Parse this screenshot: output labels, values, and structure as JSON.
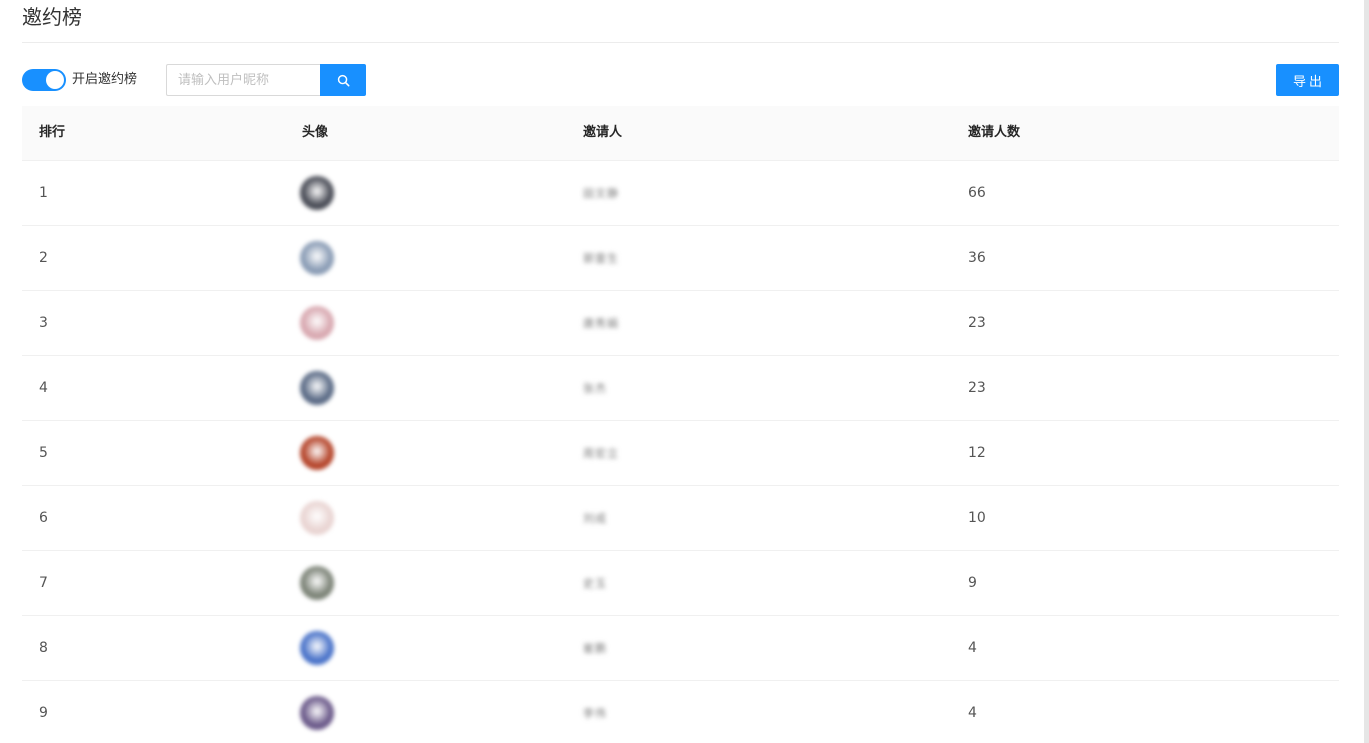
{
  "page": {
    "title": "邀约榜"
  },
  "toolbar": {
    "switch_on": true,
    "switch_label": "开启邀约榜",
    "search_placeholder": "请输入用户昵称",
    "search_icon": "search-icon",
    "export_label": "导出"
  },
  "colors": {
    "primary": "#1890ff"
  },
  "table": {
    "headers": {
      "rank": "排行",
      "avatar": "头像",
      "inviter": "邀请人",
      "count": "邀请人数"
    },
    "rows": [
      {
        "rank": "1",
        "name": "田文静",
        "count": "66",
        "avatar_color": "#4a4d57"
      },
      {
        "rank": "2",
        "name": "郭雷生",
        "count": "36",
        "avatar_color": "#8a9cb5"
      },
      {
        "rank": "3",
        "name": "唐秀娟",
        "count": "23",
        "avatar_color": "#d8a8b0"
      },
      {
        "rank": "4",
        "name": "张杰",
        "count": "23",
        "avatar_color": "#5b6b86"
      },
      {
        "rank": "5",
        "name": "周宏立",
        "count": "12",
        "avatar_color": "#b5452b"
      },
      {
        "rank": "6",
        "name": "刘成",
        "count": "10",
        "avatar_color": "#e9d4d2"
      },
      {
        "rank": "7",
        "name": "史玉",
        "count": "9",
        "avatar_color": "#7d8478"
      },
      {
        "rank": "8",
        "name": "崔鹏",
        "count": "4",
        "avatar_color": "#4a73c9"
      },
      {
        "rank": "9",
        "name": "李伟",
        "count": "4",
        "avatar_color": "#6b5a8a"
      }
    ]
  }
}
